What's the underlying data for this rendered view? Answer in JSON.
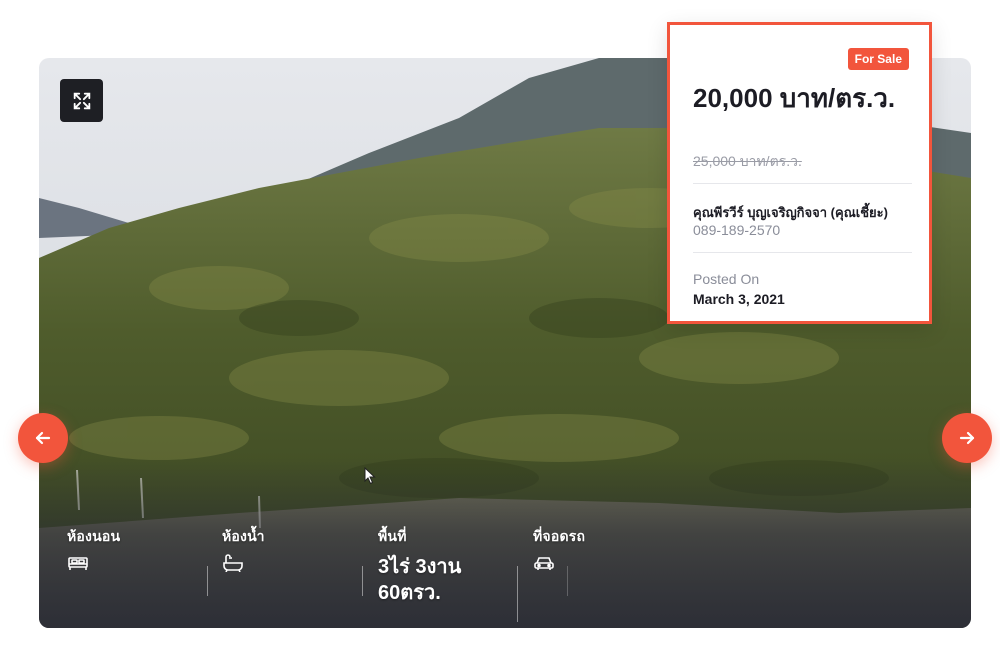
{
  "listing": {
    "features": [
      {
        "label": "ห้องนอน",
        "icon": "bed-icon"
      },
      {
        "label": "ห้องน้ำ",
        "icon": "bathtub-icon"
      },
      {
        "label": "พื้นที่",
        "value": "3ไร่ 3งาน 60ตรว."
      },
      {
        "label": "ที่จอดรถ",
        "icon": "car-icon"
      }
    ]
  },
  "card": {
    "badge": "For Sale",
    "price": "20,000 บาท/ตร.ว.",
    "old_price": "25,000 บาท/ตร.ว.",
    "agent_name": "คุณพีรวีร์ บุญเจริญกิจจา (คุณเชี้ยะ)",
    "agent_phone": "089-189-2570",
    "posted_label": "Posted On",
    "posted_date": "March 3, 2021"
  },
  "icons": {
    "fullscreen": "fullscreen-icon",
    "prev": "arrow-left-icon",
    "next": "arrow-right-icon"
  },
  "colors": {
    "accent": "#f2553c",
    "text_dark": "#1c1c24",
    "text_muted": "#8a8d99"
  }
}
